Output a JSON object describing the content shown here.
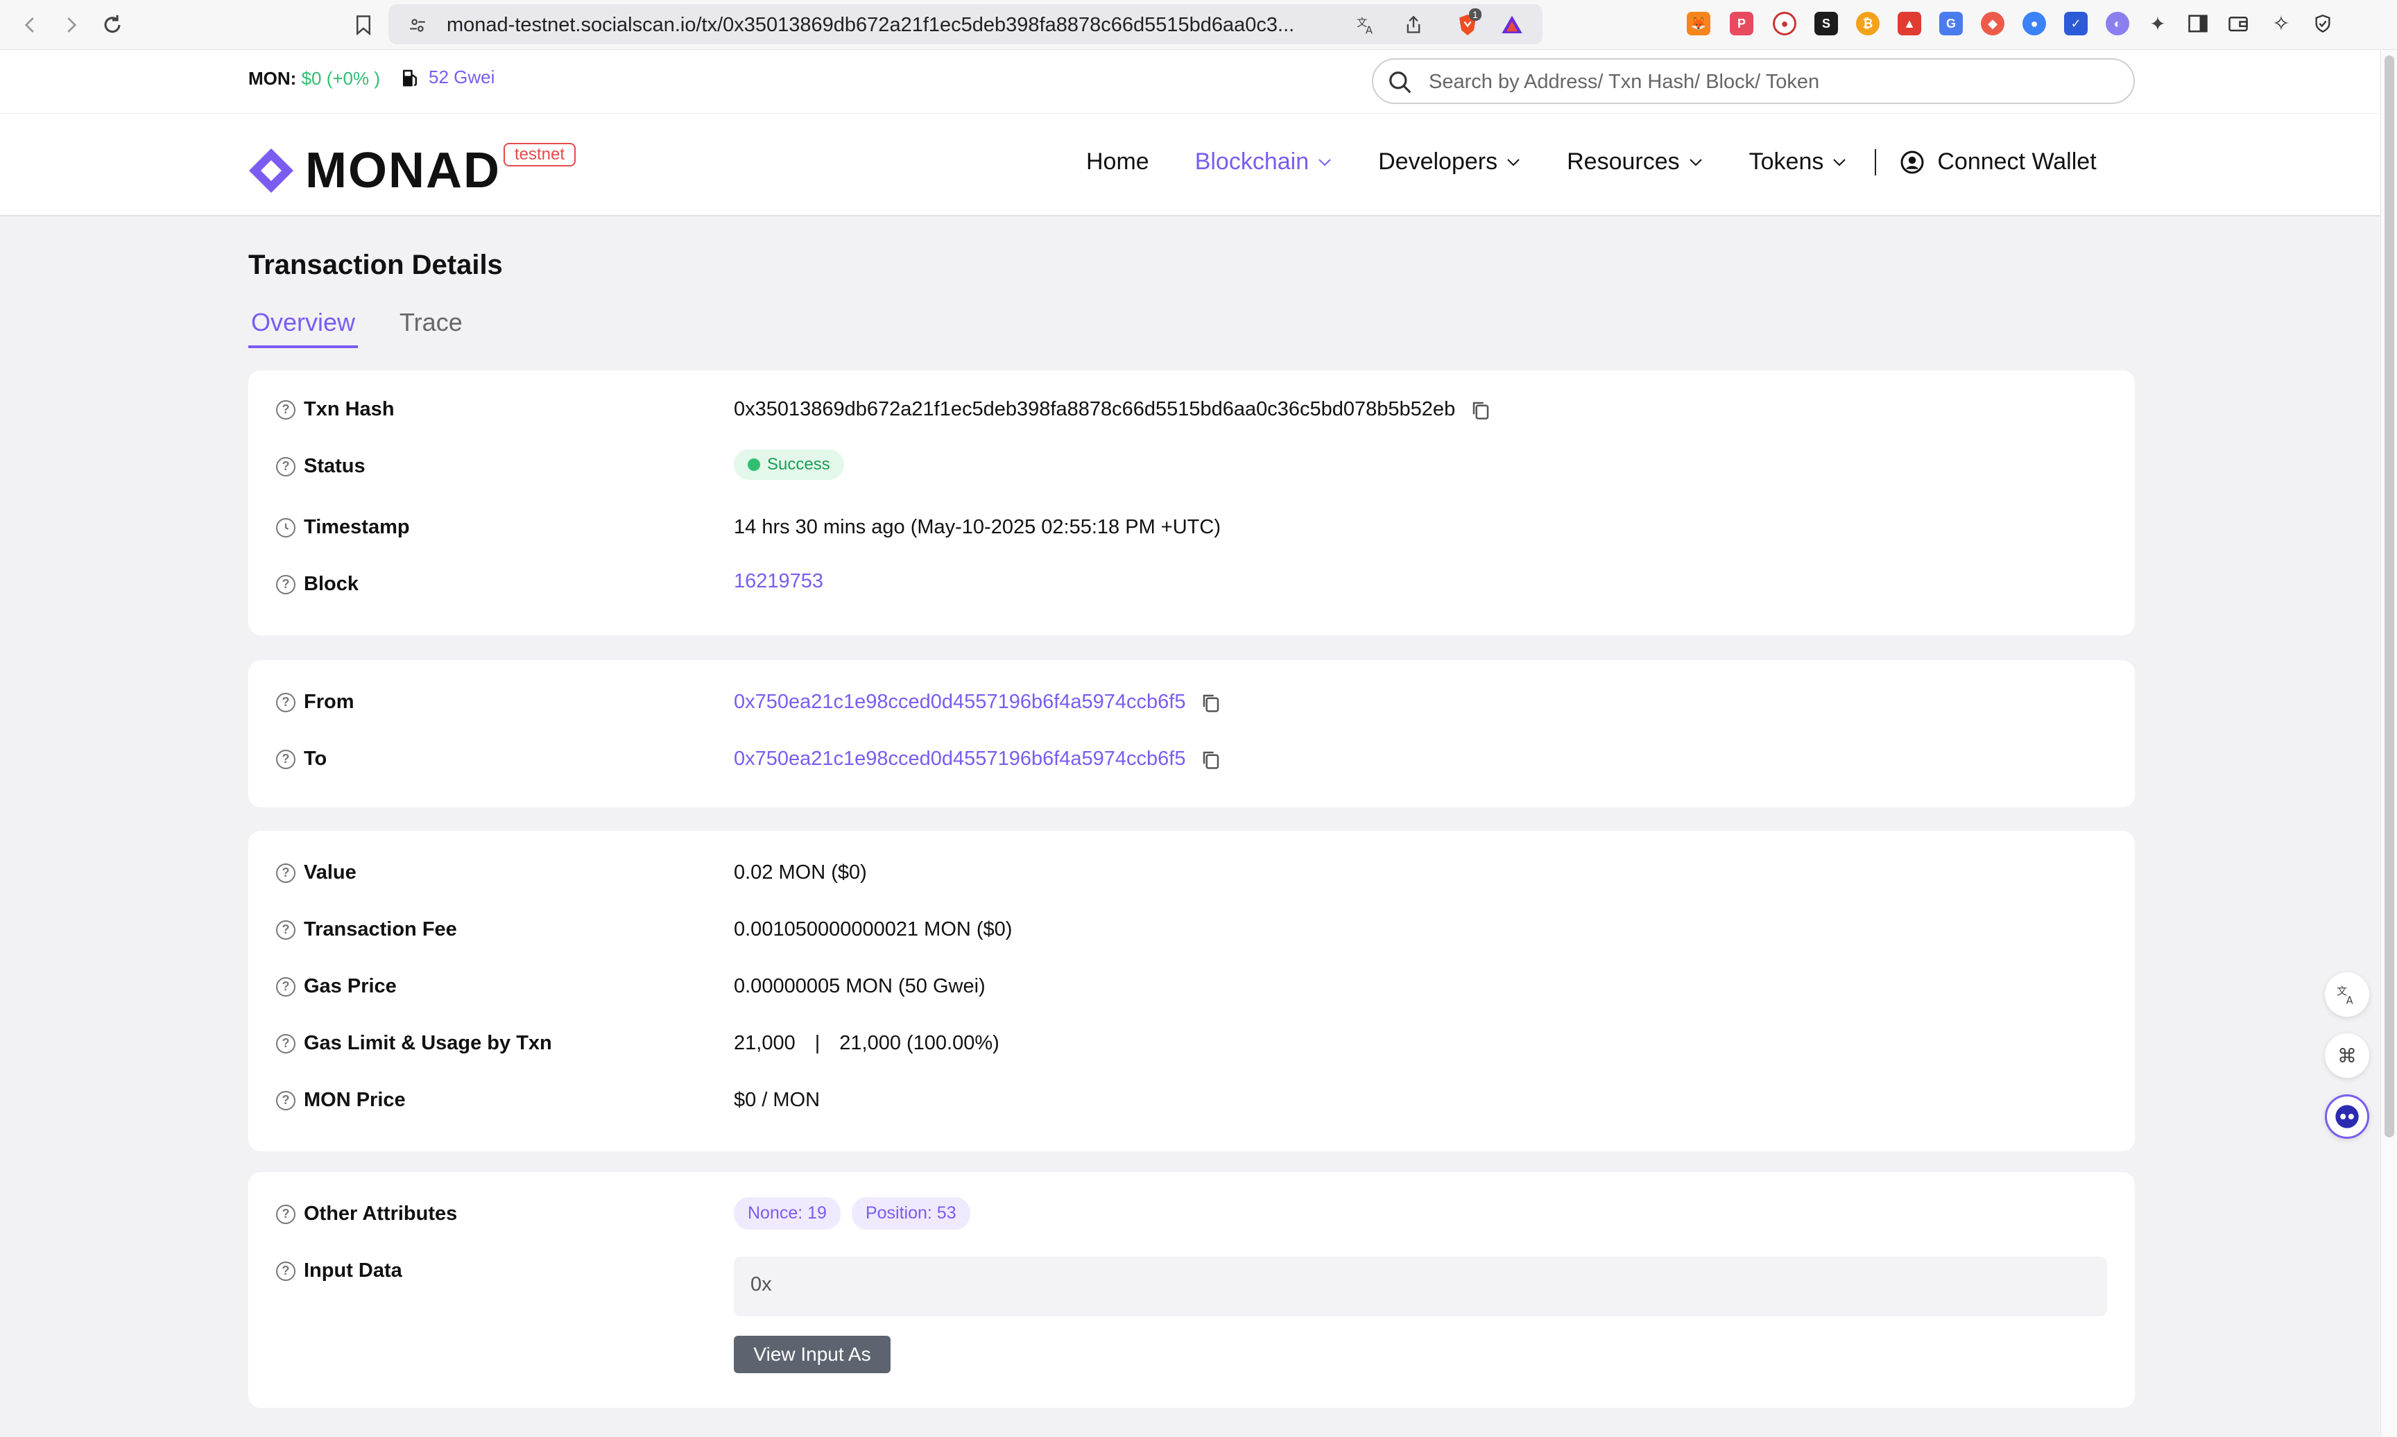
{
  "browser": {
    "url": "monad-testnet.socialscan.io/tx/0x35013869db672a21f1ec5deb398fa8878c66d5515bd6aa0c3...",
    "brave_badge_count": "1"
  },
  "topbar": {
    "price_label": "MON:",
    "price_value": "$0 (+0% )",
    "gas_value": "52 Gwei",
    "search_placeholder": "Search by Address/ Txn Hash/ Block/ Token"
  },
  "header": {
    "logo_text": "MONAD",
    "network_badge": "testnet",
    "nav": [
      {
        "label": "Home"
      },
      {
        "label": "Blockchain"
      },
      {
        "label": "Developers"
      },
      {
        "label": "Resources"
      },
      {
        "label": "Tokens"
      }
    ],
    "connect_wallet": "Connect Wallet"
  },
  "page": {
    "title": "Transaction Details",
    "tabs": [
      {
        "label": "Overview"
      },
      {
        "label": "Trace"
      }
    ]
  },
  "overview": {
    "txn_hash_label": "Txn Hash",
    "txn_hash": "0x35013869db672a21f1ec5deb398fa8878c66d5515bd6aa0c36c5bd078b5b52eb",
    "status_label": "Status",
    "status": "Success",
    "timestamp_label": "Timestamp",
    "timestamp": "14 hrs 30 mins ago (May-10-2025 02:55:18 PM +UTC)",
    "block_label": "Block",
    "block": "16219753"
  },
  "parties": {
    "from_label": "From",
    "from": "0x750ea21c1e98cced0d4557196b6f4a5974ccb6f5",
    "to_label": "To",
    "to": "0x750ea21c1e98cced0d4557196b6f4a5974ccb6f5"
  },
  "values": {
    "value_label": "Value",
    "value": "0.02 MON ($0)",
    "fee_label": "Transaction Fee",
    "fee": "0.001050000000021 MON ($0)",
    "gas_price_label": "Gas Price",
    "gas_price": "0.00000005 MON (50 Gwei)",
    "gas_limit_label": "Gas Limit & Usage by Txn",
    "gas_limit": "21,000",
    "gas_usage": "21,000 (100.00%)",
    "mon_price_label": "MON Price",
    "mon_price": "$0 / MON"
  },
  "other": {
    "attributes_label": "Other Attributes",
    "nonce": "Nonce: 19",
    "position": "Position: 53",
    "input_label": "Input Data",
    "input_data": "0x",
    "view_input_button": "View Input As"
  },
  "colors": {
    "accent": "#7b5cf0",
    "success": "#2fbf71",
    "testnet": "#e54b4b"
  }
}
